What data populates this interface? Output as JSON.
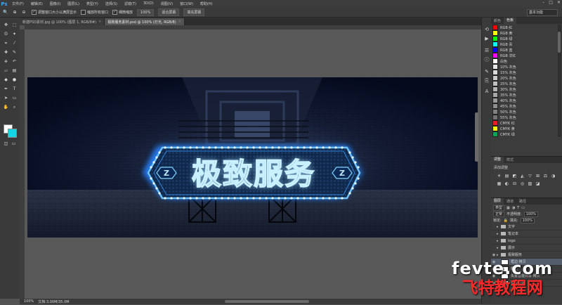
{
  "app": {
    "logo": "Ps"
  },
  "menu": [
    "文件(F)",
    "编辑(E)",
    "图像(I)",
    "图层(L)",
    "类型(Y)",
    "选择(S)",
    "滤镜(T)",
    "3D(D)",
    "视图(V)",
    "窗口(W)",
    "帮助(H)"
  ],
  "window_controls": [
    "–",
    "□",
    "✕"
  ],
  "options_bar": {
    "tool_icon": "zoom-icon",
    "check1": "调整窗口大小以满屏显示",
    "check2": "缩放所有窗口",
    "check3": "细微缩放",
    "btn1": "100%",
    "btn2": "适合屏幕",
    "btn3": "填充屏幕",
    "workspace": "基本功能"
  },
  "tabs": [
    {
      "label": "新建PSD素材.jpg @ 100% (图层 1, RGB/8#)",
      "close": "×"
    },
    {
      "label": "极致服务素材.psd @ 100% (灯光, RGB/8)",
      "close": "×"
    }
  ],
  "banner": {
    "text": "极致服务",
    "badge_left": "Z",
    "badge_right": "Z"
  },
  "status": {
    "zoom": "100%",
    "doc": "文档:3.00M/35.0M"
  },
  "tool_icons": [
    "move",
    "marquee",
    "lasso",
    "quick-select",
    "crop",
    "eyedropper",
    "healing",
    "brush",
    "clone",
    "history-brush",
    "eraser",
    "gradient",
    "blur",
    "dodge",
    "pen",
    "type",
    "path-select",
    "shape",
    "hand",
    "zoom"
  ],
  "swatches_tabs": [
    "颜色",
    "色板"
  ],
  "swatches": [
    {
      "name": "RGB 红",
      "color": "#ff0000"
    },
    {
      "name": "RGB 黄",
      "color": "#ffff00"
    },
    {
      "name": "RGB 绿",
      "color": "#00ff00"
    },
    {
      "name": "RGB 青",
      "color": "#00ffff"
    },
    {
      "name": "RGB 蓝",
      "color": "#0000ff"
    },
    {
      "name": "RGB 洋红",
      "color": "#ff00ff"
    },
    {
      "name": "白色",
      "color": "#ffffff"
    },
    {
      "name": "10% 灰色",
      "color": "#e6e6e6"
    },
    {
      "name": "15% 灰色",
      "color": "#d9d9d9"
    },
    {
      "name": "20% 灰色",
      "color": "#cccccc"
    },
    {
      "name": "25% 灰色",
      "color": "#bfbfbf"
    },
    {
      "name": "30% 灰色",
      "color": "#b3b3b3"
    },
    {
      "name": "35% 灰色",
      "color": "#a6a6a6"
    },
    {
      "name": "40% 灰色",
      "color": "#999999"
    },
    {
      "name": "45% 灰色",
      "color": "#8c8c8c"
    },
    {
      "name": "50% 灰色",
      "color": "#808080"
    },
    {
      "name": "55% 灰色",
      "color": "#737373"
    },
    {
      "name": "CMYK 红",
      "color": "#ed1c24"
    },
    {
      "name": "CMYK 黄",
      "color": "#fff200"
    },
    {
      "name": "CMYK 绿",
      "color": "#00a651"
    }
  ],
  "adjust": {
    "tabs": [
      "调整",
      "样式"
    ],
    "title": "添加调整",
    "icons": [
      "☀",
      "▤",
      "◩",
      "◭",
      "▽",
      "⊞",
      "⚖",
      "◑",
      "▦",
      "◐",
      "⊟",
      "◎",
      "▧",
      "◪"
    ]
  },
  "layers": {
    "tabs": [
      "图层",
      "通道",
      "路径"
    ],
    "kind": "类型",
    "blend": "正常",
    "opacity_label": "不透明度:",
    "opacity": "100%",
    "lock_label": "锁定:",
    "fill_label": "填充:",
    "fill": "100%",
    "rows": [
      {
        "eye": "",
        "name": "文字",
        "type": "folder",
        "selected": false
      },
      {
        "eye": "",
        "name": "笔记本",
        "type": "folder",
        "selected": false
      },
      {
        "eye": "",
        "name": "logo",
        "type": "folder",
        "selected": false
      },
      {
        "eye": "",
        "name": "展示",
        "type": "folder",
        "selected": false
      },
      {
        "eye": "◉",
        "name": "极致服务",
        "type": "folder",
        "selected": false
      },
      {
        "eye": "◉",
        "name": "框边 拷贝",
        "type": "layer",
        "selected": true
      },
      {
        "eye": "◉",
        "name": "框边",
        "type": "layer",
        "selected": false
      },
      {
        "eye": "◉",
        "name": "矢量智能对象 拷贝",
        "type": "layer",
        "selected": false
      },
      {
        "eye": "◉",
        "name": "极致服务",
        "type": "layer",
        "selected": false
      }
    ]
  },
  "watermark": {
    "top": "fevte.com",
    "bottom": "飞特教程网"
  }
}
